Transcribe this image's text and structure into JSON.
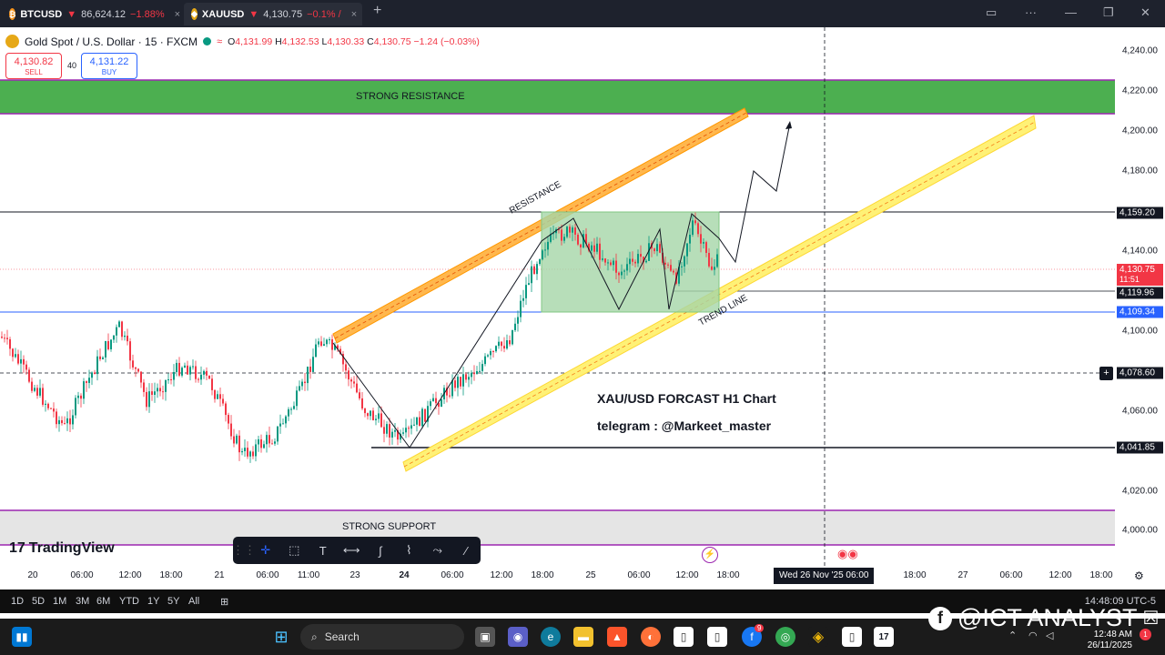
{
  "tabs": [
    {
      "symbol": "BTCUSD",
      "price": "86,624.12",
      "change": "−1.88%",
      "close": "×",
      "icon": "bitcoin-icon",
      "icon_glyph": "₿",
      "icon_color": "#f7931a"
    },
    {
      "symbol": "XAUUSD",
      "price": "4,130.75",
      "change": "−0.1% / ",
      "close": "×",
      "icon": "gold-icon",
      "icon_glyph": "◆",
      "icon_color": "#e6a817"
    }
  ],
  "new_tab": "+",
  "window_controls": {
    "layout": "▭",
    "more": "···",
    "minimize": "—",
    "maximize": "❐",
    "close": "✕"
  },
  "header": {
    "title": "Gold Spot / U.S. Dollar · 15 · FXCM",
    "market_status": "≈",
    "ohlc": {
      "o_label": "O",
      "o": "4,131.99",
      "h_label": "H",
      "h": "4,132.53",
      "l_label": "L",
      "l": "4,130.33",
      "c_label": "C",
      "c": "4,130.75",
      "change": "−1.24 (−0.03%)"
    }
  },
  "trade": {
    "sell_price": "4,130.82",
    "sell_label": "SELL",
    "spread": "40",
    "buy_price": "4,131.22",
    "buy_label": "BUY"
  },
  "annotations": {
    "strong_resistance": "STRONG RESISTANCE",
    "strong_support": "STRONG SUPPORT",
    "resistance": "RESISTANCE",
    "trend_line": "TREND LINE",
    "forecast": "XAU/USD FORCAST  H1 Chart",
    "telegram": "telegram : @Markeet_master"
  },
  "price_scale": {
    "ticks": [
      "4,240.00",
      "4,220.00",
      "4,200.00",
      "4,180.00",
      "4,140.00",
      "4,100.00",
      "4,060.00",
      "4,020.00",
      "4,000.00"
    ],
    "tags": [
      {
        "text": "4,159.20",
        "color": "#131722"
      },
      {
        "text": "4,130.75",
        "sub": "11:51",
        "color": "#f23645"
      },
      {
        "text": "4,119.96",
        "color": "#131722"
      },
      {
        "text": "4,109.34",
        "color": "#2962ff"
      },
      {
        "text": "4,078.60",
        "color": "#131722"
      },
      {
        "text": "4,041.85",
        "color": "#131722"
      }
    ]
  },
  "time_axis": {
    "labels": [
      "20",
      "06:00",
      "12:00",
      "18:00",
      "21",
      "06:00",
      "11:00",
      "23",
      "24",
      "06:00",
      "12:00",
      "18:00",
      "25",
      "06:00",
      "12:00",
      "18:00",
      "18:00",
      "27",
      "06:00",
      "12:00",
      "18:00"
    ],
    "crosshair": "Wed 26 Nov '25   06:00"
  },
  "brand": "TradingView",
  "ranges": [
    "1D",
    "5D",
    "1M",
    "3M",
    "6M",
    "YTD",
    "1Y",
    "5Y",
    "All"
  ],
  "clock": "14:48:09 UTC-5",
  "taskbar": {
    "search": "Search",
    "time": "12:48 AM",
    "date": "26/11/2025",
    "notif": "1",
    "badge": "9"
  },
  "watermark": "@ICT ANALYST",
  "watermark_x": "☒",
  "colors": {
    "up": "#089981",
    "down": "#f23645",
    "resistance_zone": "#4caf50",
    "support_zone": "#e0e0e0",
    "channel_orange": "#ff9800",
    "channel_yellow": "#fdd835",
    "accent": "#2962ff"
  }
}
